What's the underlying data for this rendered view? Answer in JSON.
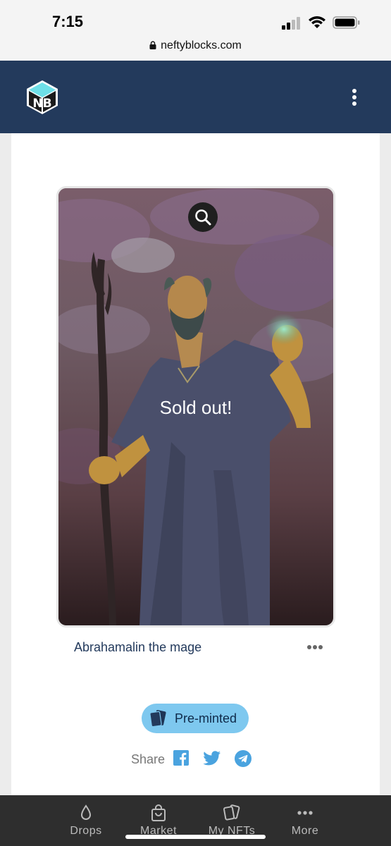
{
  "status_bar": {
    "time": "7:15"
  },
  "browser": {
    "url": "neftyblocks.com"
  },
  "header": {
    "logo_text": "NB"
  },
  "nft": {
    "overlay_text": "Sold out!",
    "title": "Abrahamalin the mage"
  },
  "badge": {
    "label": "Pre-minted"
  },
  "share": {
    "label": "Share"
  },
  "bottom_nav": {
    "items": [
      {
        "label": "Drops",
        "icon": "drop-icon"
      },
      {
        "label": "Market",
        "icon": "shopping-bag-icon"
      },
      {
        "label": "My NFTs",
        "icon": "cards-icon"
      },
      {
        "label": "More",
        "icon": "more-dots-icon"
      }
    ]
  },
  "colors": {
    "header": "#233a5c",
    "badge": "#7ec8ef",
    "nav": "#2e2e2e",
    "share_blue": "#1d9bf0"
  }
}
